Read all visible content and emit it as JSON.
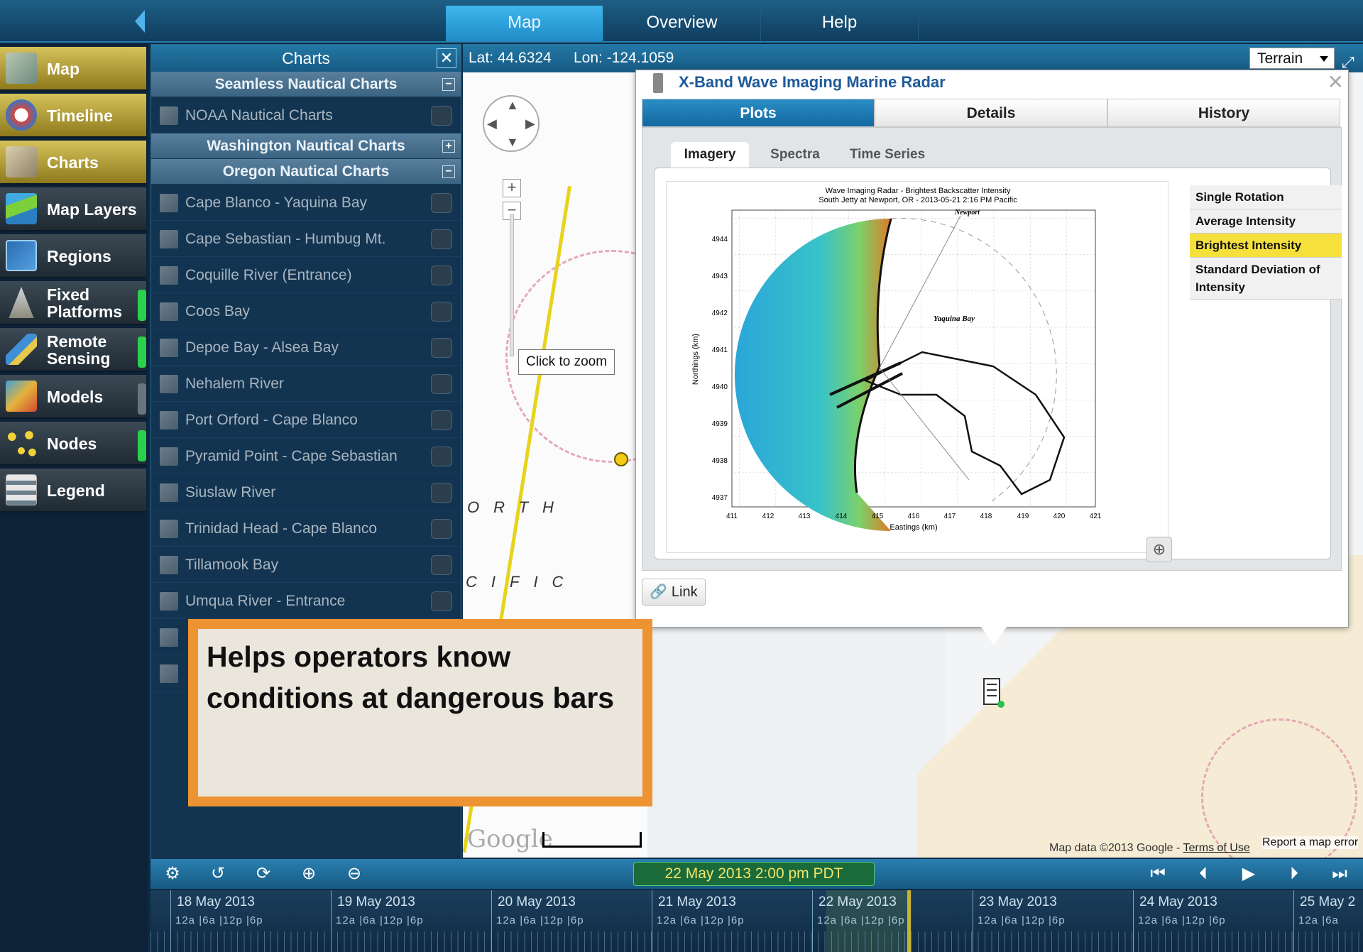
{
  "nav": {
    "tabs": [
      {
        "label": "Map",
        "active": true
      },
      {
        "label": "Overview",
        "active": false
      },
      {
        "label": "Help",
        "active": false
      }
    ]
  },
  "sidebar": {
    "items": [
      {
        "label": "Map",
        "icon": "map-icon",
        "style": "gold"
      },
      {
        "label": "Timeline",
        "icon": "clock-icon",
        "style": "gold"
      },
      {
        "label": "Charts",
        "icon": "chart-icon",
        "style": "gold"
      },
      {
        "label": "Map Layers",
        "icon": "layers-icon",
        "style": "dark"
      },
      {
        "label": "Regions",
        "icon": "regions-icon",
        "style": "dark"
      },
      {
        "label": "Fixed Platforms",
        "icon": "buoy-icon",
        "style": "dark",
        "status": "green"
      },
      {
        "label": "Remote Sensing",
        "icon": "satellite-icon",
        "style": "dark",
        "status": "green"
      },
      {
        "label": "Models",
        "icon": "model-icon",
        "style": "dark",
        "status": "grey"
      },
      {
        "label": "Nodes",
        "icon": "nodes-icon",
        "style": "dark",
        "status": "green"
      },
      {
        "label": "Legend",
        "icon": "legend-icon",
        "style": "dark"
      }
    ]
  },
  "charts_panel": {
    "title": "Charts",
    "sections": [
      {
        "label": "Seamless Nautical Charts",
        "toggle": "−"
      },
      {
        "label": "Washington Nautical Charts",
        "toggle": "+"
      },
      {
        "label": "Oregon Nautical Charts",
        "toggle": "−"
      }
    ],
    "seamless_items": [
      "NOAA Nautical Charts"
    ],
    "oregon_items": [
      "Cape Blanco - Yaquina Bay",
      "Cape Sebastian - Humbug Mt.",
      "Coquille River (Entrance)",
      "Coos Bay",
      "Depoe Bay - Alsea Bay",
      "Nehalem River",
      "Port Orford - Cape Blanco",
      "Pyramid Point - Cape Sebastian",
      "Siuslaw River",
      "Trinidad Head - Cape Blanco",
      "Tillamook Bay",
      "Umqua River - Entrance"
    ]
  },
  "callout": {
    "text": "Helps operators know conditions at dangerous bars",
    "border_color": "#ee9332"
  },
  "map": {
    "lat": "Lat: 44.6324",
    "lon": "Lon: -124.1059",
    "base_layer": "Terrain",
    "zoom_tooltip": "Click to zoom",
    "letters_row1": "ORTH",
    "letters_row2": "CIFIC",
    "google": "Google",
    "credit_prefix": "Map data ©2013 Google - ",
    "credit_link": "Terms of Use",
    "report": "Report a map error"
  },
  "popup": {
    "title": "X-Band Wave Imaging Marine Radar",
    "tabs": [
      "Plots",
      "Details",
      "History"
    ],
    "subtabs": [
      "Imagery",
      "Spectra",
      "Time Series"
    ],
    "modes": [
      {
        "label": "Single Rotation",
        "selected": false
      },
      {
        "label": "Average Intensity",
        "selected": false
      },
      {
        "label": "Brightest Intensity",
        "selected": true
      },
      {
        "label": "Standard Deviation of Intensity",
        "selected": false
      }
    ],
    "link_label": "Link"
  },
  "plot": {
    "title_line1": "Wave Imaging Radar - Brightest Backscatter Intensity",
    "title_line2": "South Jetty at Newport, OR - 2013-05-21  2:16 PM Pacific",
    "xlabel": "Eastings (km)",
    "ylabel": "Northings (km)",
    "xticks": [
      "411",
      "412",
      "413",
      "414",
      "415",
      "416",
      "417",
      "418",
      "419",
      "420",
      "421"
    ],
    "yticks": [
      "4944",
      "4943",
      "4942",
      "4941",
      "4940",
      "4939",
      "4938",
      "4937"
    ],
    "place1": "Newport",
    "place2": "Yaquina Bay"
  },
  "timebar": {
    "current": "22 May 2013  2:00 pm PDT",
    "days": [
      {
        "label": "18 May 2013",
        "hours": "12a |6a  |12p |6p"
      },
      {
        "label": "19 May 2013",
        "hours": "12a |6a  |12p |6p"
      },
      {
        "label": "20 May 2013",
        "hours": "12a |6a  |12p |6p"
      },
      {
        "label": "21 May 2013",
        "hours": "12a |6a  |12p |6p"
      },
      {
        "label": "22 May 2013",
        "hours": "12a |6a  |12p |6p"
      },
      {
        "label": "23 May 2013",
        "hours": "12a |6a  |12p |6p"
      },
      {
        "label": "24 May 2013",
        "hours": "12a |6a  |12p |6p"
      },
      {
        "label": "25 May 2",
        "hours": "12a |6a"
      }
    ]
  }
}
